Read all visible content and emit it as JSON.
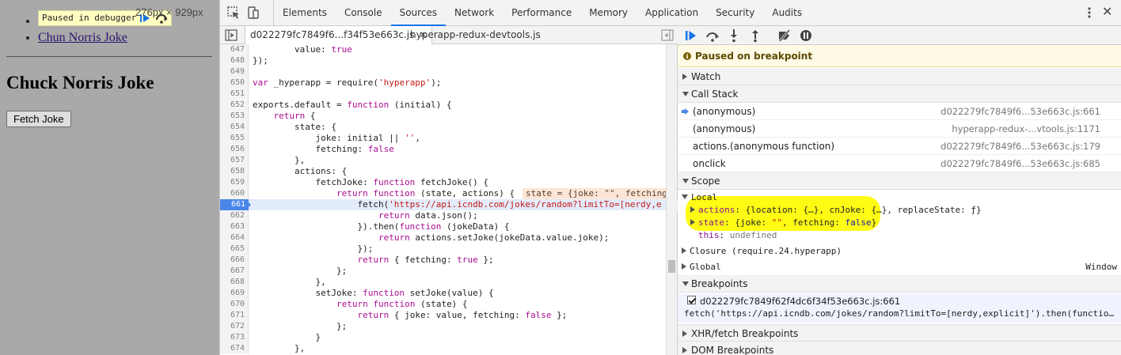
{
  "page": {
    "links": [
      "Chun Norris Joke"
    ],
    "heading": "Chuck Norris Joke",
    "fetch_button": "Fetch Joke",
    "paused_overlay": "Paused in debugger",
    "dimensions": "276px × 929px"
  },
  "devtools": {
    "tabs": [
      "Elements",
      "Console",
      "Sources",
      "Network",
      "Performance",
      "Memory",
      "Application",
      "Security",
      "Audits"
    ],
    "active_tab": "Sources",
    "accent_color": "#1a73e8",
    "file_tabs": [
      {
        "name": "d022279fc7849f6...f34f53e663c.js",
        "active": true
      },
      {
        "name": "hyperapp-redux-devtools.js",
        "active": false
      }
    ],
    "code_lines": [
      {
        "num": "647",
        "text": "        value: true"
      },
      {
        "num": "648",
        "text": "});"
      },
      {
        "num": "649",
        "text": ""
      },
      {
        "num": "650",
        "text": "var _hyperapp = require('hyperapp');"
      },
      {
        "num": "651",
        "text": ""
      },
      {
        "num": "652",
        "text": "exports.default = function (initial) {"
      },
      {
        "num": "653",
        "text": "    return {"
      },
      {
        "num": "654",
        "text": "        state: {"
      },
      {
        "num": "655",
        "text": "            joke: initial || '',"
      },
      {
        "num": "656",
        "text": "            fetching: false"
      },
      {
        "num": "657",
        "text": "        },"
      },
      {
        "num": "658",
        "text": "        actions: {"
      },
      {
        "num": "659",
        "text": "            fetchJoke: function fetchJoke() {"
      },
      {
        "num": "660",
        "text": "                return function (state, actions) {"
      },
      {
        "num": "661",
        "text": "                    fetch('https://api.icndb.com/jokes/random?limitTo=[nerdy,e"
      },
      {
        "num": "662",
        "text": "                        return data.json();"
      },
      {
        "num": "663",
        "text": "                    }).then(function (jokeData) {"
      },
      {
        "num": "664",
        "text": "                        return actions.setJoke(jokeData.value.joke);"
      },
      {
        "num": "665",
        "text": "                    });"
      },
      {
        "num": "666",
        "text": "                    return { fetching: true };"
      },
      {
        "num": "667",
        "text": "                };"
      },
      {
        "num": "668",
        "text": "            },"
      },
      {
        "num": "669",
        "text": "            setJoke: function setJoke(value) {"
      },
      {
        "num": "670",
        "text": "                return function (state) {"
      },
      {
        "num": "671",
        "text": "                    return { joke: value, fetching: false };"
      },
      {
        "num": "672",
        "text": "                };"
      },
      {
        "num": "673",
        "text": "            }"
      },
      {
        "num": "674",
        "text": "        },"
      }
    ],
    "current_line": "661",
    "inline_value_line": "660",
    "inline_value": "state = {joke: \"\", fetching",
    "debugger": {
      "paused_message": "Paused on breakpoint",
      "sections": {
        "watch": "Watch",
        "call_stack": "Call Stack",
        "scope": "Scope",
        "breakpoints": "Breakpoints",
        "xhr": "XHR/fetch Breakpoints",
        "dom": "DOM Breakpoints"
      },
      "call_stack": [
        {
          "fn": "(anonymous)",
          "loc": "d022279fc7849f6...53e663c.js:661",
          "current": true
        },
        {
          "fn": "(anonymous)",
          "loc": "hyperapp-redux-...vtools.js:1171",
          "current": false
        },
        {
          "fn": "actions.(anonymous function)",
          "loc": "d022279fc7849f6...53e663c.js:179",
          "current": false
        },
        {
          "fn": "onclick",
          "loc": "d022279fc7849f6...53e663c.js:685",
          "current": false
        }
      ],
      "scope": {
        "local_label": "Local",
        "actions_name": "actions",
        "actions_value": "{location: {…}, cnJoke: {…}, replaceState: ƒ}",
        "state_name": "state",
        "state_value_prefix": "{joke: ",
        "state_value_joke": "\"\"",
        "state_value_mid": ", fetching: ",
        "state_value_fetching": "false",
        "state_value_suffix": "}",
        "this_name": "this",
        "this_value": "undefined",
        "closure_label": "Closure (require.24.hyperapp)",
        "global_label": "Global",
        "global_value": "Window"
      },
      "breakpoint": {
        "file": "d022279fc7849f62f4dc6f34f53e663c.js:661",
        "code": "fetch('https://api.icndb.com/jokes/random?limitTo=[nerdy,explicit]').then(functio…"
      },
      "highlight_color": "#fffb14"
    }
  }
}
